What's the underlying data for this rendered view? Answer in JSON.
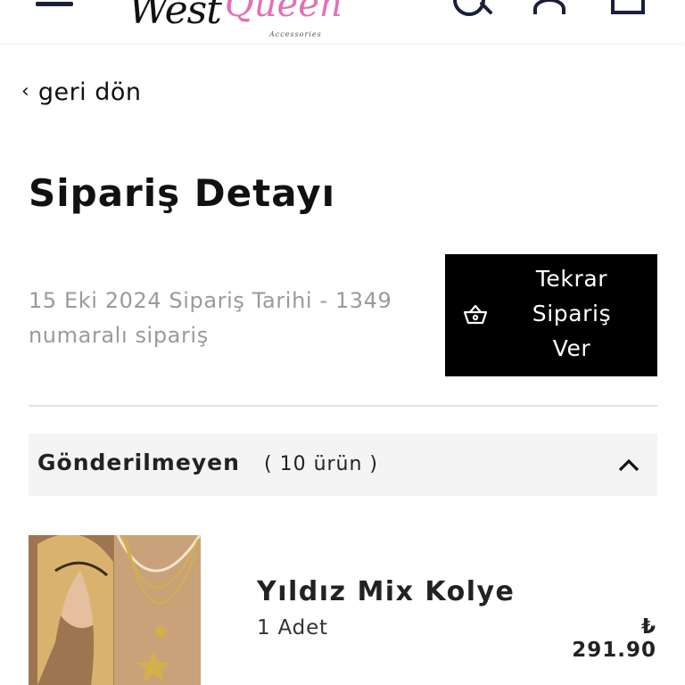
{
  "header": {
    "menu_icon": "hamburger-menu-icon",
    "logo": {
      "west": "West",
      "queen": "Queen",
      "sub": "Accessories"
    },
    "icons": [
      "search-icon",
      "user-icon",
      "shopping-bag-icon"
    ]
  },
  "back": {
    "label": "geri dön",
    "chevron": "‹"
  },
  "page_title": "Sipariş Detayı",
  "order": {
    "meta_line1": "15 Eki 2024 Sipariş Tarihi - 1349",
    "meta_line2": "numaralı sipariş"
  },
  "reorder_button": {
    "line1": "Tekrar",
    "line2": "Sipariş",
    "line3": "Ver",
    "icon": "basket-icon"
  },
  "group": {
    "title": "Gönderilmeyen",
    "count": "( 10 ürün )",
    "expanded": true
  },
  "product": {
    "name": "Yıldız Mix Kolye",
    "quantity": "1 Adet",
    "price": "₺ 291.90"
  },
  "colors": {
    "accent_pink": "#e46fb5",
    "button_bg": "#000000",
    "muted_text": "#9a9a9a",
    "group_bg": "#f4f4f4"
  }
}
